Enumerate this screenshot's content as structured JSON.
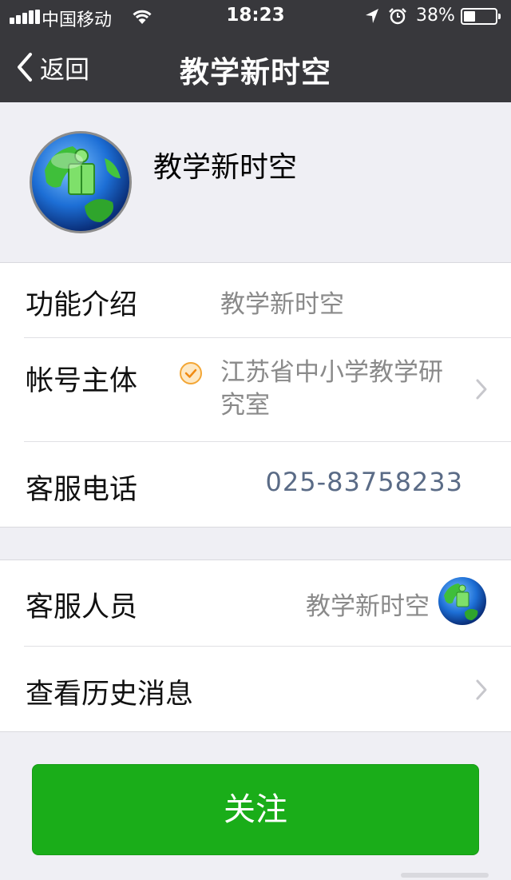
{
  "status_bar": {
    "carrier": "中国移动",
    "time": "18:23",
    "battery_percent": "38%",
    "battery_level": 0.38,
    "icons": [
      "signal-icon",
      "wifi-icon",
      "location-arrow-icon",
      "alarm-clock-icon",
      "battery-icon"
    ]
  },
  "nav": {
    "back_label": "返回",
    "title": "教学新时空"
  },
  "profile": {
    "name": "教学新时空",
    "avatar_icon": "globe-book-logo"
  },
  "info": {
    "intro": {
      "label": "功能介绍",
      "value": "教学新时空"
    },
    "owner": {
      "label": "帐号主体",
      "value": "江苏省中小学教学研究室",
      "verified_icon": "verified-check-icon"
    },
    "phone": {
      "label": "客服电话",
      "value": "025-83758233"
    }
  },
  "service": {
    "staff": {
      "label": "客服人员",
      "value": "教学新时空"
    },
    "history": {
      "label": "查看历史消息"
    }
  },
  "follow_button": {
    "label": "关注"
  },
  "colors": {
    "nav_bg": "#38383c",
    "page_bg": "#efeff4",
    "button_green": "#1aad19",
    "phone_link": "#5a6b86",
    "verified_orange": "#f3a635"
  }
}
